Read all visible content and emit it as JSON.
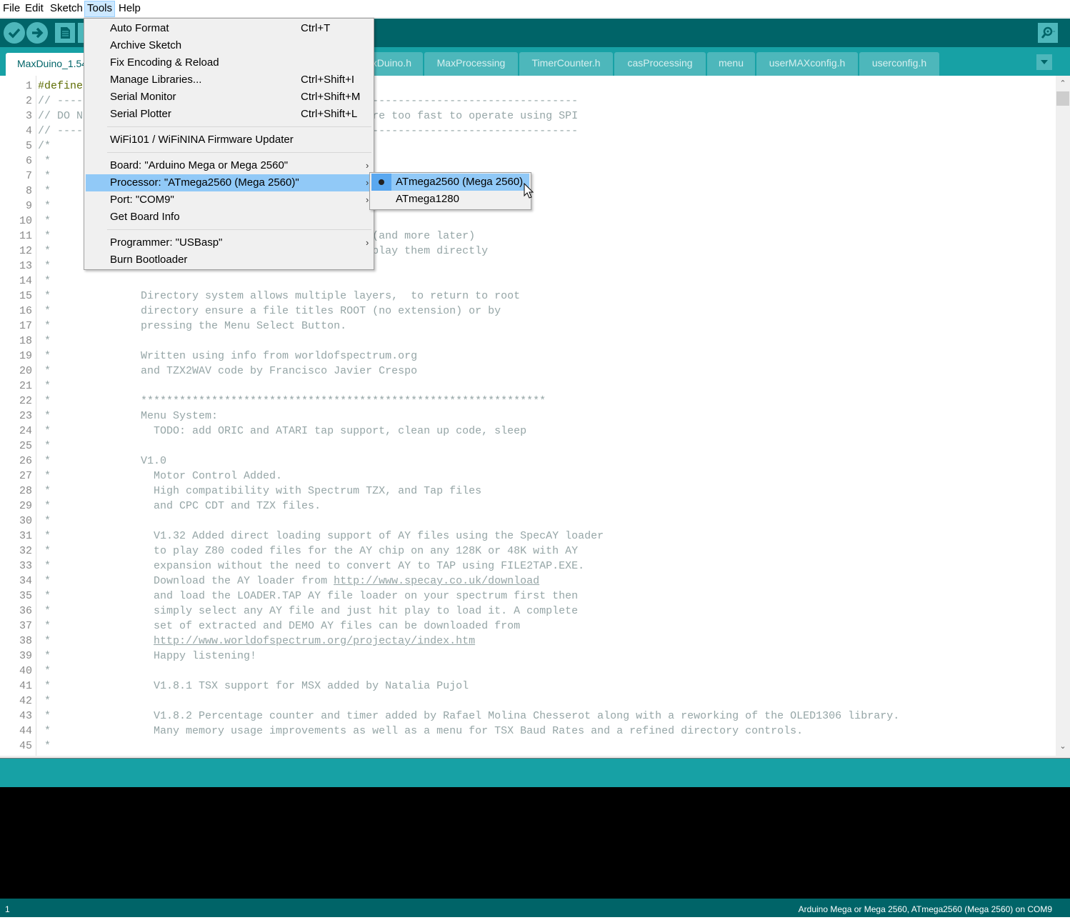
{
  "menubar": {
    "items": [
      "File",
      "Edit",
      "Sketch",
      "Tools",
      "Help"
    ],
    "open": "Tools"
  },
  "toolbar": {
    "buttons": [
      {
        "name": "verify",
        "icon": "check-icon"
      },
      {
        "name": "upload",
        "icon": "arrow-right-icon"
      },
      {
        "name": "new",
        "icon": "new-file-icon"
      },
      {
        "name": "open",
        "icon": "open-icon"
      }
    ],
    "serial_monitor_icon": "magnifier-icon"
  },
  "tabs": [
    {
      "label": "MaxDuino_1.54",
      "active": true
    },
    {
      "label": "MaxDuino.h"
    },
    {
      "label": "MaxProcessing"
    },
    {
      "label": "TimerCounter.h"
    },
    {
      "label": "casProcessing"
    },
    {
      "label": "menu"
    },
    {
      "label": "userMAXconfig.h"
    },
    {
      "label": "userconfig.h"
    }
  ],
  "tools_menu": {
    "items": [
      {
        "label": "Auto Format",
        "shortcut": "Ctrl+T"
      },
      {
        "label": "Archive Sketch",
        "shortcut": ""
      },
      {
        "label": "Fix Encoding & Reload",
        "shortcut": ""
      },
      {
        "label": "Manage Libraries...",
        "shortcut": "Ctrl+Shift+I"
      },
      {
        "label": "Serial Monitor",
        "shortcut": "Ctrl+Shift+M"
      },
      {
        "label": "Serial Plotter",
        "shortcut": "Ctrl+Shift+L"
      },
      {
        "label": "WiFi101 / WiFiNINA Firmware Updater",
        "shortcut": ""
      },
      {
        "label": "Board: \"Arduino Mega or Mega 2560\"",
        "submenu": true
      },
      {
        "label": "Processor: \"ATmega2560 (Mega 2560)\"",
        "submenu": true,
        "highlighted": true
      },
      {
        "label": "Port: \"COM9\"",
        "submenu": true
      },
      {
        "label": "Get Board Info"
      },
      {
        "label": "Programmer: \"USBasp\"",
        "submenu": true
      },
      {
        "label": "Burn Bootloader"
      }
    ]
  },
  "processor_submenu": {
    "items": [
      {
        "label": "ATmega2560 (Mega 2560)",
        "selected": true
      },
      {
        "label": "ATmega1280",
        "selected": false
      }
    ]
  },
  "editor": {
    "lines": [
      "#define",
      "// ---------------------------------------------------------------------------------",
      "// DO N                                             re too fast to operate using SPI",
      "// ---------------------------------------------------------------------------------",
      "/*",
      " *",
      " *",
      " *",
      " *",
      " *",
      " *                                                  (and more later)",
      " *                                                  play them directly",
      " *",
      " *",
      " *              Directory system allows multiple layers,  to return to root",
      " *              directory ensure a file titles ROOT (no extension) or by",
      " *              pressing the Menu Select Button.",
      " *",
      " *              Written using info from worldofspectrum.org",
      " *              and TZX2WAV code by Francisco Javier Crespo",
      " *",
      " *              ***************************************************************",
      " *              Menu System:",
      " *                TODO: add ORIC and ATARI tap support, clean up code, sleep",
      " *",
      " *              V1.0",
      " *                Motor Control Added.",
      " *                High compatibility with Spectrum TZX, and Tap files",
      " *                and CPC CDT and TZX files.",
      " *",
      " *                V1.32 Added direct loading support of AY files using the SpecAY loader",
      " *                to play Z80 coded files for the AY chip on any 128K or 48K with AY",
      " *                expansion without the need to convert AY to TAP using FILE2TAP.EXE.",
      " *                Download the AY loader from http://www.specay.co.uk/download",
      " *                and load the LOADER.TAP AY file loader on your spectrum first then",
      " *                simply select any AY file and just hit play to load it. A complete",
      " *                set of extracted and DEMO AY files can be downloaded from",
      " *                http://www.worldofspectrum.org/projectay/index.htm",
      " *                Happy listening!",
      " *",
      " *                V1.8.1 TSX support for MSX added by Natalia Pujol",
      " *",
      " *                V1.8.2 Percentage counter and timer added by Rafael Molina Chesserot along with a reworking of the OLED1306 library.",
      " *                Many memory usage improvements as well as a menu for TSX Baud Rates and a refined directory controls.",
      " *"
    ]
  },
  "status": {
    "line": "1",
    "board": "Arduino Mega or Mega 2560, ATmega2560 (Mega 2560) on COM9"
  },
  "colors": {
    "toolbar": "#006468",
    "tabbar": "#17a1a5",
    "button": "#4db7bb",
    "highlight": "#91c9f7",
    "keyword": "#5e6d03",
    "comment": "#95a5a6"
  }
}
